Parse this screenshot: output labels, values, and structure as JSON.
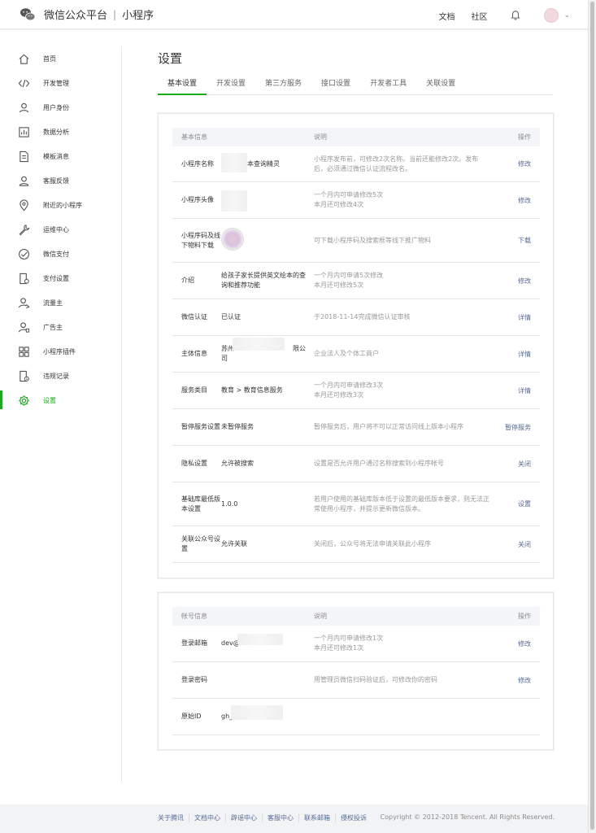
{
  "header": {
    "brand_name": "微信公众平台",
    "brand_sep": "|",
    "product_name": "小程序",
    "links": [
      "文档",
      "社区"
    ],
    "icons": [
      "wechat-logo-icon",
      "bell-icon",
      "avatar",
      "chevron-down-icon"
    ]
  },
  "sidebar": {
    "items": [
      {
        "label": "首页",
        "icon": "home-icon"
      },
      {
        "label": "开发管理",
        "icon": "code-icon"
      },
      {
        "label": "用户身份",
        "icon": "user-icon"
      },
      {
        "label": "数据分析",
        "icon": "chart-icon"
      },
      {
        "label": "模板消息",
        "icon": "document-icon"
      },
      {
        "label": "客服反馈",
        "icon": "customer-service-icon"
      },
      {
        "label": "附近的小程序",
        "icon": "location-icon"
      },
      {
        "label": "运维中心",
        "icon": "wrench-icon"
      },
      {
        "label": "微信支付",
        "icon": "wechat-pay-icon"
      },
      {
        "label": "支付设置",
        "icon": "payment-settings-icon"
      },
      {
        "label": "流量主",
        "icon": "traffic-user-icon"
      },
      {
        "label": "广告主",
        "icon": "advertiser-icon"
      },
      {
        "label": "小程序插件",
        "icon": "plugin-icon"
      },
      {
        "label": "违规记录",
        "icon": "violation-record-icon"
      },
      {
        "label": "设置",
        "icon": "settings-gear-icon",
        "active": true
      }
    ],
    "active_color": "#1aad19"
  },
  "main": {
    "title": "设置",
    "tabs": [
      "基本设置",
      "开发设置",
      "第三方服务",
      "接口设置",
      "开发者工具",
      "关联设置"
    ],
    "active_tab": 0
  },
  "basic_info": {
    "headers": [
      "基本信息",
      "说明",
      "操作"
    ],
    "rows": [
      {
        "name": "小程序名称",
        "value": "本查询精灵",
        "desc": "小程序发布前，可修改2次名称。当前还能修改2次。发布后，必须通过微信认证流程改名。",
        "action": "修改"
      },
      {
        "name": "小程序头像",
        "value": "",
        "desc": "一个月内可申请修改5次\n本月还可修改4次",
        "action": "修改"
      },
      {
        "name": "小程序码及线下物料下载",
        "value": "",
        "desc": "可下载小程序码及搜索框等线下推广物料",
        "action": "下载"
      },
      {
        "name": "介绍",
        "value": "给孩子家长提供英文绘本的查询和推荐功能",
        "desc": "一个月内可申请5次修改\n本月还可修改5次",
        "action": "修改"
      },
      {
        "name": "微信认证",
        "value": "已认证",
        "desc": "于2018-11-14完成微信认证审核",
        "action": "详情"
      },
      {
        "name": "主体信息",
        "value": "苏州　　　　　　　　　限公司",
        "desc": "企业法人及个体工商户",
        "action": "详情"
      },
      {
        "name": "服务类目",
        "value": "教育 > 教育信息服务",
        "desc": "一个月内可申请修改3次\n本月还可修改3次",
        "action": "详情"
      },
      {
        "name": "暂停服务设置",
        "value": "未暂停服务",
        "desc": "暂停服务后，用户将不可以正常访问线上版本小程序",
        "action": "暂停服务"
      },
      {
        "name": "隐私设置",
        "value": "允许被搜索",
        "desc": "设置是否允许用户通过名称搜索到小程序帐号",
        "action": "关闭"
      },
      {
        "name": "基础库最低版本设置",
        "value": "1.0.0",
        "desc": "若用户使用的基础库版本低于设置的最低版本要求，则无法正常使用小程序，并提示更新微信版本。",
        "action": "设置"
      },
      {
        "name": "关联公众号设置",
        "value": "允许关联",
        "desc": "关闭后，公众号将无法申请关联此小程序",
        "action": "关闭"
      }
    ]
  },
  "account_info": {
    "headers": [
      "帐号信息",
      "说明",
      "操作"
    ],
    "rows": [
      {
        "name": "登录邮箱",
        "value": "dev@",
        "desc": "一个月内可申请修改1次\n本月还可修改1次",
        "action": "修改"
      },
      {
        "name": "登录密码",
        "value": "",
        "desc": "用管理员微信扫码验证后，可修改你的密码",
        "action": "修改"
      },
      {
        "name": "原始ID",
        "value": "gh_",
        "desc": "",
        "action": ""
      }
    ]
  },
  "footer": {
    "links": [
      "关于腾讯",
      "文档中心",
      "辟谣中心",
      "客服中心",
      "联系邮箱",
      "侵权投诉"
    ],
    "copyright": "Copyright © 2012-2018 Tencent. All Rights Reserved."
  }
}
